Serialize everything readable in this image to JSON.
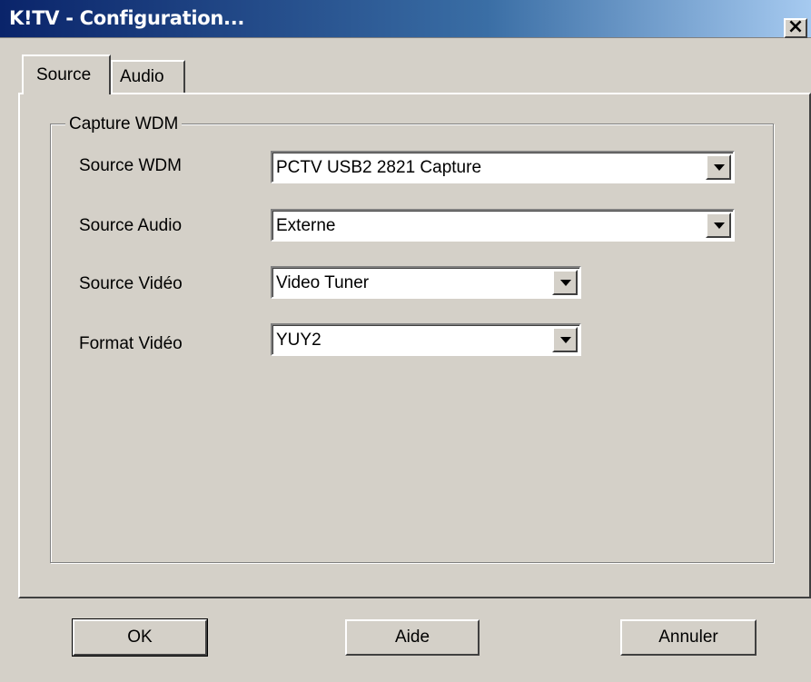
{
  "window": {
    "title": "K!TV - Configuration...",
    "close": "×"
  },
  "tabs": [
    {
      "label": "Source"
    },
    {
      "label": "Audio"
    }
  ],
  "group": {
    "label": "Capture WDM"
  },
  "fields": [
    {
      "label": "Source WDM",
      "value": "PCTV USB2 2821 Capture"
    },
    {
      "label": "Source Audio",
      "value": "Externe"
    },
    {
      "label": "Source Vidéo",
      "value": "Video Tuner"
    },
    {
      "label": "Format Vidéo",
      "value": "YUY2"
    }
  ],
  "buttons": {
    "ok": "OK",
    "help": "Aide",
    "cancel": "Annuler"
  }
}
